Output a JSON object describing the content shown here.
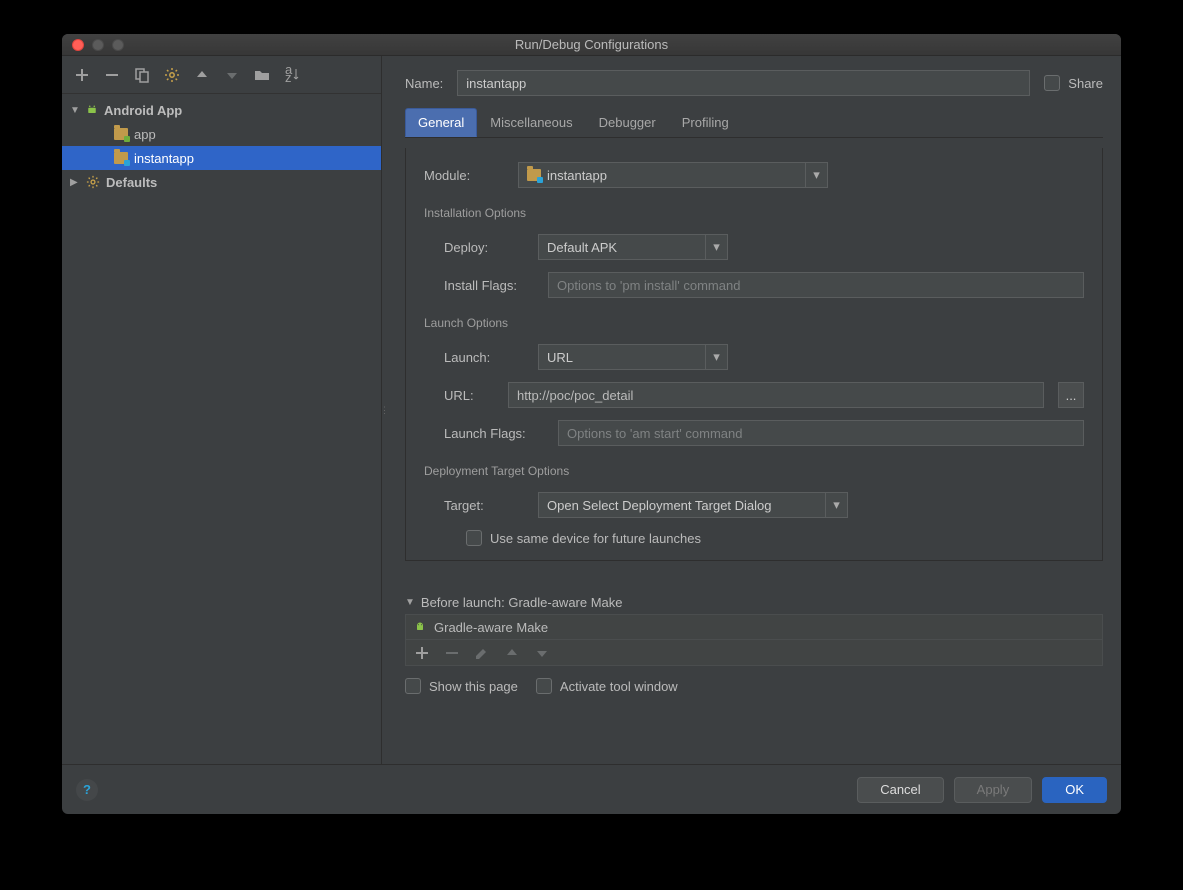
{
  "window": {
    "title": "Run/Debug Configurations"
  },
  "share_label": "Share",
  "name_label": "Name:",
  "name_value": "instantapp",
  "tree": {
    "root_label": "Android App",
    "items": [
      "app",
      "instantapp"
    ],
    "defaults_label": "Defaults"
  },
  "tabs": [
    "General",
    "Miscellaneous",
    "Debugger",
    "Profiling"
  ],
  "module": {
    "label": "Module:",
    "value": "instantapp"
  },
  "install": {
    "section": "Installation Options",
    "deploy_label": "Deploy:",
    "deploy_value": "Default APK",
    "flags_label": "Install Flags:",
    "flags_placeholder": "Options to 'pm install' command"
  },
  "launch": {
    "section": "Launch Options",
    "launch_label": "Launch:",
    "launch_value": "URL",
    "url_label": "URL:",
    "url_value": "http://poc/poc_detail",
    "flags_label": "Launch Flags:",
    "flags_placeholder": "Options to 'am start' command"
  },
  "deployment": {
    "section": "Deployment Target Options",
    "target_label": "Target:",
    "target_value": "Open Select Deployment Target Dialog",
    "same_device_label": "Use same device for future launches"
  },
  "before": {
    "header": "Before launch: Gradle-aware Make",
    "item": "Gradle-aware Make"
  },
  "footer_opts": {
    "show_page": "Show this page",
    "activate_tool": "Activate tool window"
  },
  "buttons": {
    "cancel": "Cancel",
    "apply": "Apply",
    "ok": "OK"
  },
  "more_btn": "..."
}
